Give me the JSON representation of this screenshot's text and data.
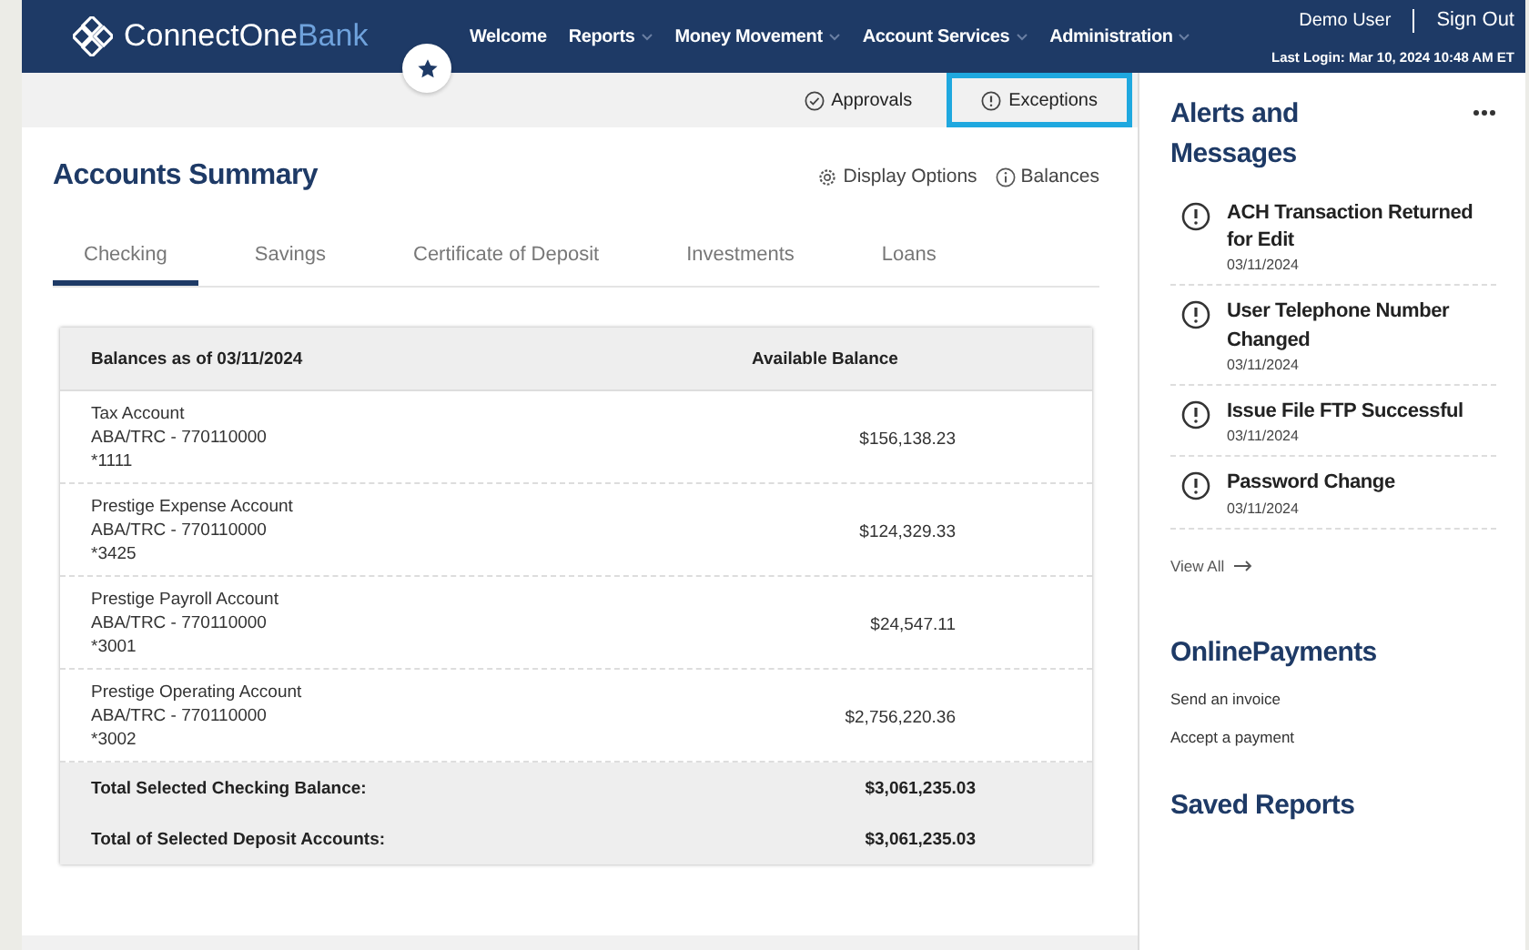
{
  "header": {
    "logo": {
      "name": "ConnectOne",
      "accent": "Bank"
    },
    "nav": [
      {
        "label": "Welcome",
        "has_menu": false
      },
      {
        "label": "Reports",
        "has_menu": true
      },
      {
        "label": "Money Movement",
        "has_menu": true
      },
      {
        "label": "Account Services",
        "has_menu": true
      },
      {
        "label": "Administration",
        "has_menu": true
      }
    ],
    "user": "Demo User",
    "sign_out": "Sign Out",
    "last_login": "Last Login: Mar 10, 2024 10:48 AM ET"
  },
  "subbar": [
    {
      "kind": "check",
      "label": "Approvals",
      "highlighted": false
    },
    {
      "kind": "alert",
      "label": "Exceptions",
      "highlighted": true
    }
  ],
  "accounts_summary": {
    "title": "Accounts Summary",
    "actions": [
      {
        "kind": "gear",
        "label": "Display Options"
      },
      {
        "kind": "info",
        "label": "Balances"
      }
    ],
    "tabs": [
      {
        "label": "Checking",
        "selected": true
      },
      {
        "label": "Savings",
        "selected": false
      },
      {
        "label": "Certificate of Deposit",
        "selected": false
      },
      {
        "label": "Investments",
        "selected": false
      },
      {
        "label": "Loans",
        "selected": false
      }
    ],
    "table": {
      "columns": [
        "Balances as of 03/11/2024",
        "Available Balance"
      ],
      "rows": [
        {
          "name": "Tax Account",
          "routing": "ABA/TRC - 770110000",
          "number": "*1111",
          "balance": "$156,138.23"
        },
        {
          "name": "Prestige Expense Account",
          "routing": "ABA/TRC - 770110000",
          "number": "*3425",
          "balance": "$124,329.33"
        },
        {
          "name": "Prestige Payroll Account",
          "routing": "ABA/TRC - 770110000",
          "number": "*3001",
          "balance": "$24,547.11"
        },
        {
          "name": "Prestige Operating Account",
          "routing": "ABA/TRC - 770110000",
          "number": "*3002",
          "balance": "$2,756,220.36"
        }
      ],
      "totals": [
        {
          "label": "Total Selected Checking Balance:",
          "value": "$3,061,235.03"
        },
        {
          "label": "Total of Selected Deposit Accounts:",
          "value": "$3,061,235.03"
        }
      ]
    }
  },
  "alerts": {
    "title": "Alerts and Messages",
    "items": [
      {
        "title": "ACH Transaction Returned for Edit",
        "date": "03/11/2024"
      },
      {
        "title": "User Telephone Number Changed",
        "date": "03/11/2024"
      },
      {
        "title": "Issue File FTP Successful",
        "date": "03/11/2024"
      },
      {
        "title": "Password Change",
        "date": "03/11/2024"
      }
    ],
    "view_all": "View All"
  },
  "online_payments": {
    "title": "OnlinePayments",
    "links": [
      "Send an invoice",
      "Accept a payment"
    ]
  },
  "saved_reports": {
    "title": "Saved Reports"
  }
}
